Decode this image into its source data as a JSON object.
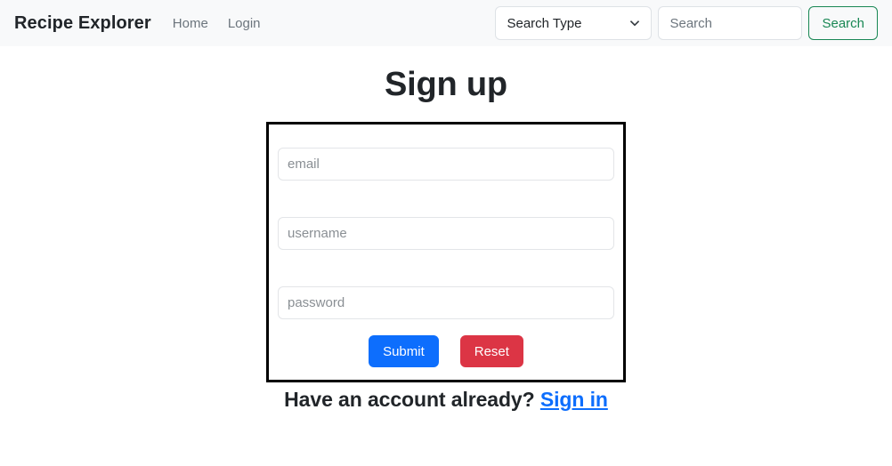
{
  "navbar": {
    "brand": "Recipe Explorer",
    "links": [
      {
        "label": "Home"
      },
      {
        "label": "Login"
      }
    ],
    "search_type": {
      "selected": "Search Type",
      "icon": "chevron-down-icon"
    },
    "search_field": {
      "value": "",
      "placeholder": "Search"
    },
    "search_button": {
      "label": "Search",
      "color": "#198754"
    },
    "background": "#f8f9fa"
  },
  "main": {
    "title": "Sign up",
    "form": {
      "border_color": "#000000",
      "fields": [
        {
          "name": "email",
          "placeholder": "email",
          "value": ""
        },
        {
          "name": "username",
          "placeholder": "username",
          "value": ""
        },
        {
          "name": "password",
          "placeholder": "password",
          "value": ""
        }
      ],
      "buttons": {
        "submit": {
          "label": "Submit",
          "color": "#0d6efd"
        },
        "reset": {
          "label": "Reset",
          "color": "#dc3545"
        }
      }
    },
    "footer": {
      "text": "Have an account already?",
      "link_label": "Sign in",
      "link_color": "#0d6efd"
    }
  }
}
